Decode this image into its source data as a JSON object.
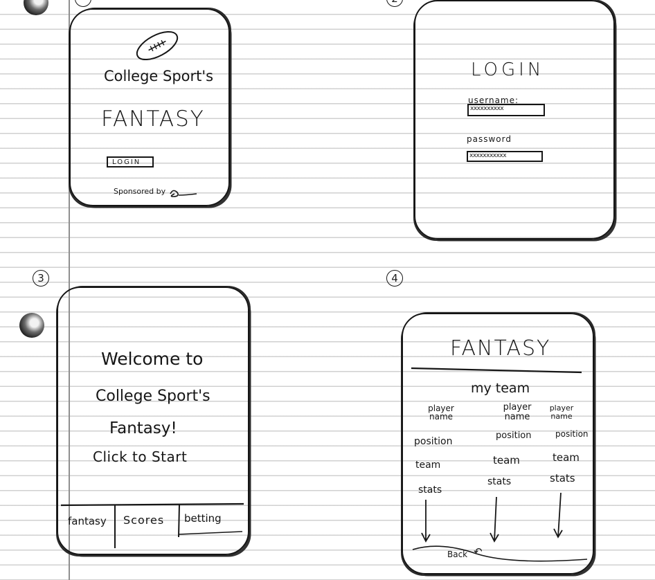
{
  "screens": [
    {
      "number": "",
      "title_line": "College Sport's",
      "headline": "FANTASY",
      "login_button": "LOGIN",
      "footer": "Sponsored by"
    },
    {
      "number": "2",
      "title": "LOGIN",
      "username_label": "username:",
      "username_value": "xxxxxxxxxx",
      "password_label": "password",
      "password_value": "xxxxxxxxxxx"
    },
    {
      "number": "3",
      "welcome_line1": "Welcome to",
      "welcome_line2": "College Sport's",
      "welcome_line3": "Fantasy!",
      "cta": "Click to Start",
      "tabs": [
        "fantasy",
        "Scores",
        "betting"
      ]
    },
    {
      "number": "4",
      "title": "FANTASY",
      "subtitle": "my team",
      "columns": [
        {
          "player": "player name",
          "position": "position",
          "team": "team",
          "stats": "stats"
        },
        {
          "player": "player name",
          "position": "position",
          "team": "team",
          "stats": "stats"
        },
        {
          "player": "player name",
          "position": "position",
          "team": "team",
          "stats": "stats"
        }
      ],
      "back_label": "Back"
    }
  ]
}
